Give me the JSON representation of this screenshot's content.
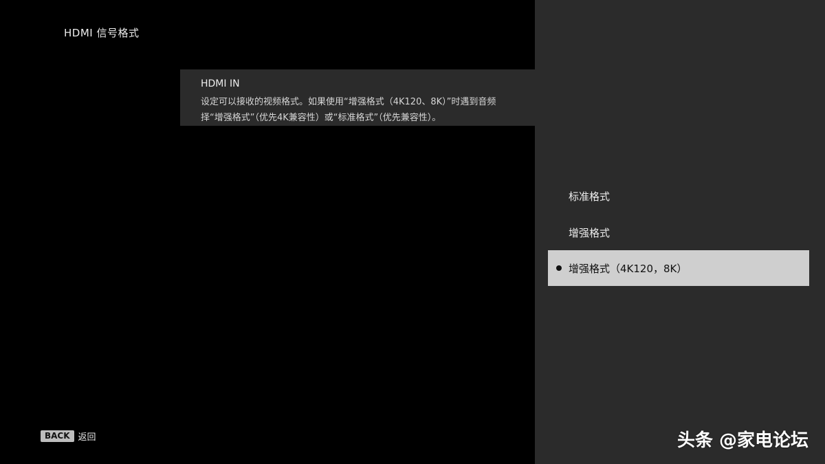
{
  "header": {
    "title": "HDMI 信号格式"
  },
  "info_panel": {
    "title": "HDMI IN",
    "line1": "设定可以接收的视频格式。如果使用“增强格式（4K120、8K）”时遇到音频",
    "line2": "择“增强格式”（优先4K兼容性）或“标准格式”（优先兼容性）。"
  },
  "options": {
    "items": [
      {
        "label": "标准格式",
        "selected": false
      },
      {
        "label": "增强格式",
        "selected": false
      },
      {
        "label": "增强格式（4K120，8K）",
        "selected": true
      }
    ]
  },
  "footer": {
    "back_key": "BACK",
    "back_label": "返回"
  },
  "watermark": {
    "text": "头条 @家电论坛"
  },
  "colors": {
    "background": "#000000",
    "panel": "#2b2b2b",
    "selected_highlight": "#cfcfcf"
  }
}
